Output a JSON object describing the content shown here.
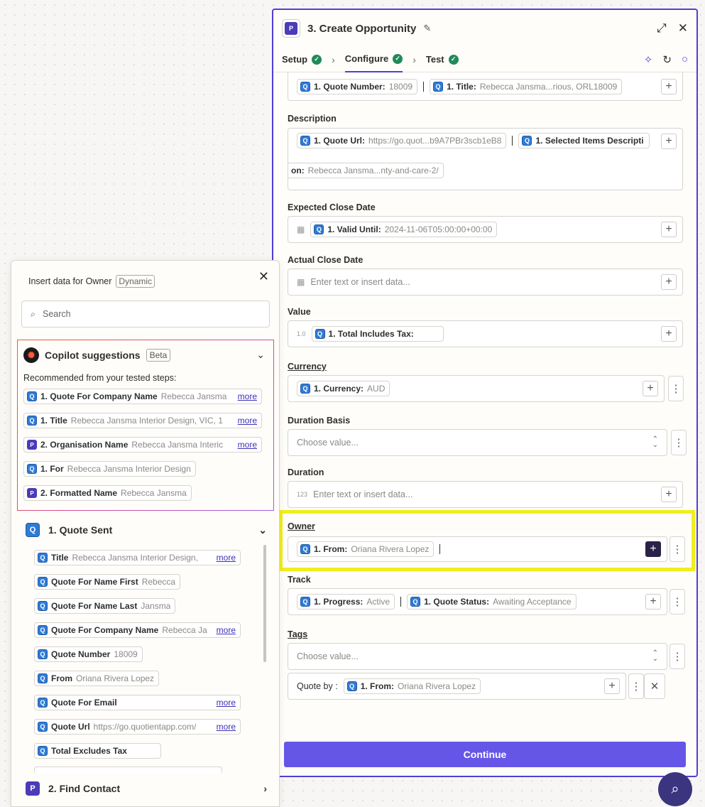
{
  "editor": {
    "title": "3. Create Opportunity",
    "tabs": [
      {
        "label": "Setup"
      },
      {
        "label": "Configure"
      },
      {
        "label": "Test"
      }
    ],
    "top_row": {
      "pill1_key": "1. Quote Number:",
      "pill1_val": "18009",
      "pill2_key": "1. Title:",
      "pill2_val": "Rebecca Jansma...rious, ORL18009"
    },
    "description": {
      "label": "Description",
      "pill1_key": "1. Quote Url:",
      "pill1_val": "https://go.quot...b9A7PBr3scb1eB8",
      "pill2_key": "1. Selected Items Descripti",
      "pill2_cont_key": "on:",
      "pill2_cont_val": "Rebecca Jansma...nty-and-care-2/"
    },
    "expected_close": {
      "label": "Expected Close Date",
      "pill_key": "1. Valid Until:",
      "pill_val": "2024-11-06T05:00:00+00:00"
    },
    "actual_close": {
      "label": "Actual Close Date",
      "placeholder": "Enter text or insert data..."
    },
    "value": {
      "label": "Value",
      "prefix": "1.0",
      "pill_key": "1. Total Includes Tax:"
    },
    "currency": {
      "label": "Currency",
      "pill_key": "1. Currency:",
      "pill_val": "AUD"
    },
    "duration_basis": {
      "label": "Duration Basis",
      "placeholder": "Choose value..."
    },
    "duration": {
      "label": "Duration",
      "prefix": "123",
      "placeholder": "Enter text or insert data..."
    },
    "owner": {
      "label": "Owner",
      "pill_key": "1. From:",
      "pill_val": "Oriana Rivera Lopez"
    },
    "track": {
      "label": "Track",
      "pill1_key": "1. Progress:",
      "pill1_val": "Active",
      "pill2_key": "1. Quote Status:",
      "pill2_val": "Awaiting Acceptance"
    },
    "tags": {
      "label": "Tags",
      "placeholder": "Choose value...",
      "sub_label": "Quote by :",
      "pill_key": "1. From:",
      "pill_val": "Oriana Rivera Lopez"
    },
    "continue_label": "Continue"
  },
  "picker": {
    "title": "Insert data for Owner",
    "badge": "Dynamic",
    "search_placeholder": "Search",
    "copilot": {
      "title": "Copilot suggestions",
      "badge": "Beta",
      "recommended": "Recommended from your tested steps:",
      "items": [
        {
          "key": "1. Quote For Company Name",
          "val": "Rebecca Jansma",
          "more": "more",
          "app": "quote"
        },
        {
          "key": "1. Title",
          "val": "Rebecca Jansma Interior Design, VIC, 1",
          "more": "more",
          "app": "quote"
        },
        {
          "key": "2. Organisation Name",
          "val": "Rebecca Jansma Interic",
          "more": "more",
          "app": "pipedrive"
        },
        {
          "key": "1. For",
          "val": "Rebecca Jansma Interior Design",
          "more": "",
          "app": "quote"
        },
        {
          "key": "2. Formatted Name",
          "val": "Rebecca Jansma",
          "more": "",
          "app": "pipedrive"
        }
      ]
    },
    "section1": {
      "title": "1.  Quote Sent"
    },
    "section1_items": [
      {
        "key": "Title",
        "val": "Rebecca Jansma Interior Design,",
        "more": "more"
      },
      {
        "key": "Quote For Name First",
        "val": "Rebecca",
        "more": ""
      },
      {
        "key": "Quote For Name Last",
        "val": "Jansma",
        "more": ""
      },
      {
        "key": "Quote For Company Name",
        "val": "Rebecca Ja",
        "more": "more"
      },
      {
        "key": "Quote Number",
        "val": "18009",
        "more": ""
      },
      {
        "key": "From",
        "val": "Oriana Rivera Lopez",
        "more": ""
      },
      {
        "key": "Quote For Email",
        "val": "",
        "more": "more"
      },
      {
        "key": "Quote Url",
        "val": "https://go.quotientapp.com/",
        "more": "more"
      },
      {
        "key": "Total Excludes Tax",
        "val": "",
        "more": ""
      }
    ],
    "section2": {
      "title": "2.  Find Contact"
    }
  }
}
